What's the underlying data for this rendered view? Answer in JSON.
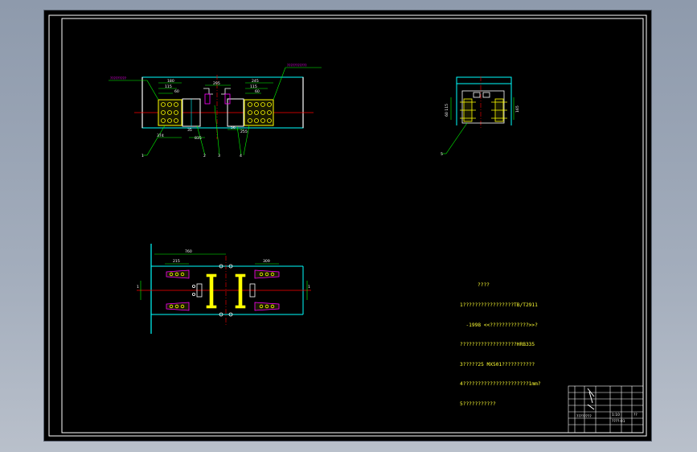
{
  "notes": {
    "heading": "????",
    "lines": [
      "1?????????????????TB/T2911",
      "  -1998 <<?????????????>>?",
      "???????????????????HRB335",
      "3?????25 MX501???????????",
      "4??????????????????????1mm?",
      "5???????????"
    ]
  },
  "dimensions": {
    "top_left": [
      "180",
      "115",
      "60",
      "295",
      "245",
      "115",
      "60",
      "374",
      "35",
      "835",
      "56",
      "255",
      "1",
      "2",
      "3",
      "4"
    ],
    "top_right": [
      "60 115",
      "165",
      "5"
    ],
    "bottom": [
      "760",
      "215",
      "309",
      "1",
      "1"
    ]
  },
  "leader_labels": {
    "left": "?????????",
    "right": "???????????"
  },
  "title_block": {
    "drawing_name": "????????",
    "scale": "1:10",
    "sheet": "??",
    "number": "????-01"
  },
  "colors": {
    "background": "#000000",
    "frame": "#ffffff",
    "structure": "#00ffff",
    "hatch": "#ffff00",
    "center_line": "#ff0000",
    "dimension": "#00ff00",
    "bolts": "#ffff00",
    "steel": "#ff00ff"
  }
}
